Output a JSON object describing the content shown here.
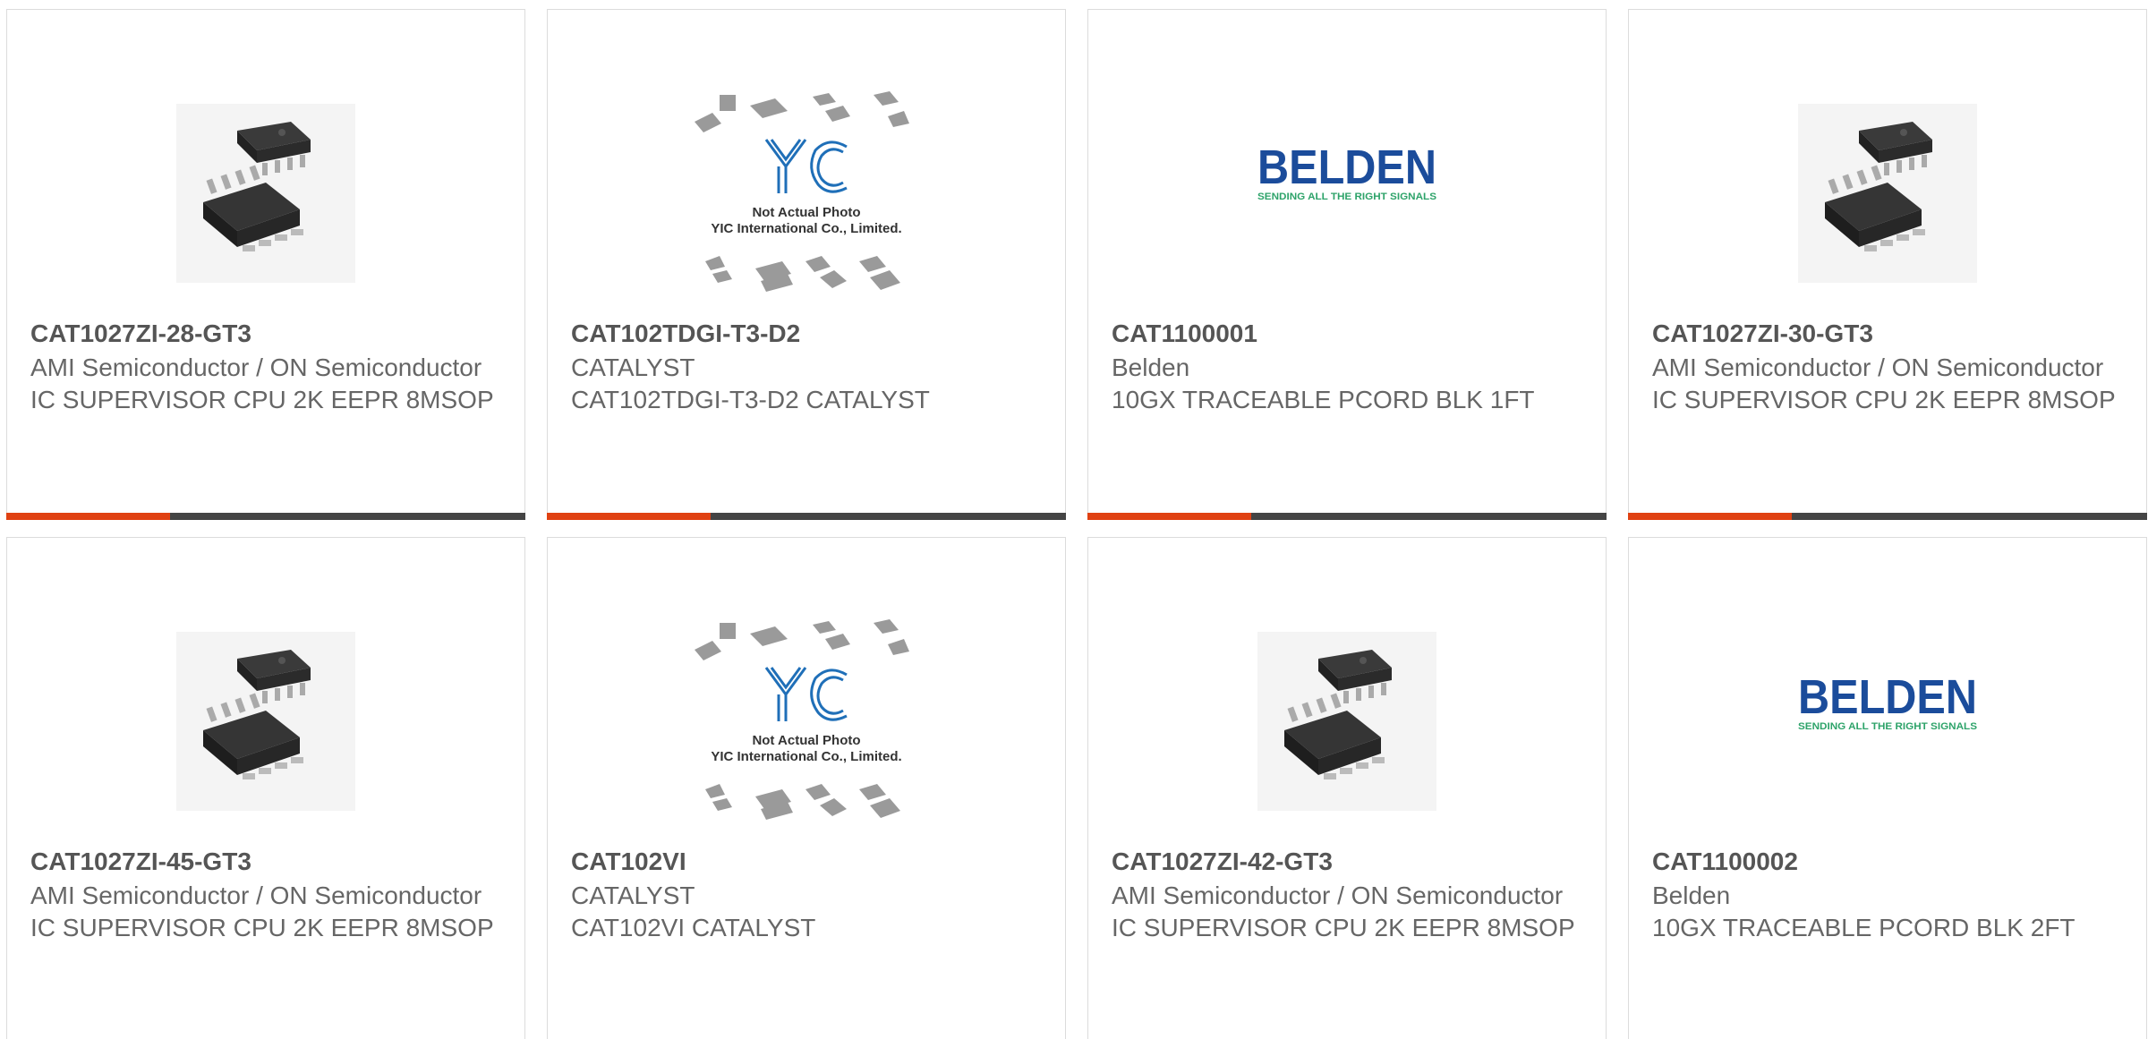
{
  "products": [
    {
      "part": "CAT1027ZI-28-GT3",
      "mfr": "AMI Semiconductor / ON Semiconductor",
      "desc": "IC SUPERVISOR CPU 2K EEPR 8MSOP",
      "image": "msop-chip-image"
    },
    {
      "part": "CAT102TDGI-T3-D2",
      "mfr": "CATALYST",
      "desc": "CAT102TDGI-T3-D2 CATALYST",
      "image": "yic-placeholder-image"
    },
    {
      "part": "CAT1100001",
      "mfr": "Belden",
      "desc": "10GX TRACEABLE PCORD BLK 1FT",
      "image": "belden-logo-image"
    },
    {
      "part": "CAT1027ZI-30-GT3",
      "mfr": "AMI Semiconductor / ON Semiconductor",
      "desc": "IC SUPERVISOR CPU 2K EEPR 8MSOP",
      "image": "msop-chip-image"
    },
    {
      "part": "CAT1027ZI-45-GT3",
      "mfr": "AMI Semiconductor / ON Semiconductor",
      "desc": "IC SUPERVISOR CPU 2K EEPR 8MSOP",
      "image": "msop-chip-image"
    },
    {
      "part": "CAT102VI",
      "mfr": "CATALYST",
      "desc": "CAT102VI CATALYST",
      "image": "yic-placeholder-image"
    },
    {
      "part": "CAT1027ZI-42-GT3",
      "mfr": "AMI Semiconductor / ON Semiconductor",
      "desc": "IC SUPERVISOR CPU 2K EEPR 8MSOP",
      "image": "msop-chip-image"
    },
    {
      "part": "CAT1100002",
      "mfr": "Belden",
      "desc": "10GX TRACEABLE PCORD BLK 2FT",
      "image": "belden-logo-image"
    }
  ],
  "placeholder": {
    "line1": "Not Actual Photo",
    "line2": "YIC International Co., Limited.",
    "logo": "YIC"
  },
  "belden": {
    "brand": "BELDEN",
    "tagline": "SENDING ALL THE RIGHT SIGNALS"
  },
  "colors": {
    "accent": "#e04112",
    "bar": "#444444",
    "belden_blue": "#1b4c9b",
    "belden_green": "#2ea36a",
    "yic_blue": "#1f6fb8"
  }
}
